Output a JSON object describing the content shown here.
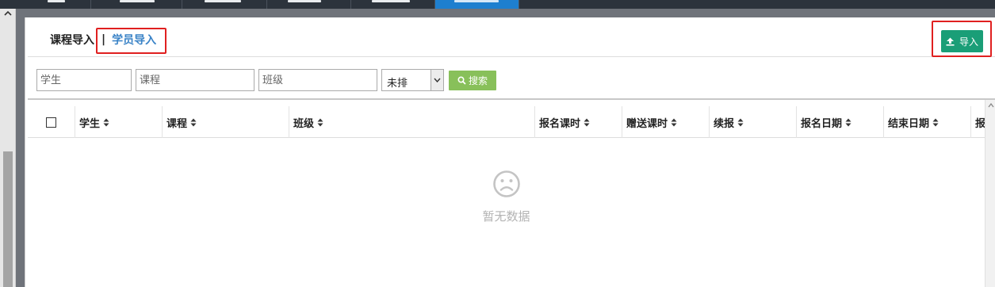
{
  "subtabs": {
    "course_import": "课程导入",
    "separator": "|",
    "student_import": "学员导入"
  },
  "toolbar": {
    "import_label": "导入",
    "import_icon": "upload-icon",
    "accent": "#1a9e77"
  },
  "filters": {
    "student_placeholder": "学生",
    "course_placeholder": "课程",
    "class_placeholder": "班级",
    "schedule_selected": "未排",
    "search_label": "搜索",
    "search_icon": "search-icon",
    "search_color": "#88c05a"
  },
  "table": {
    "columns": [
      "学生",
      "课程",
      "班级",
      "报名课时",
      "赠送课时",
      "续报",
      "报名日期",
      "结束日期",
      "报"
    ],
    "empty_text": "暂无数据",
    "empty_icon": "sad-face-icon"
  }
}
